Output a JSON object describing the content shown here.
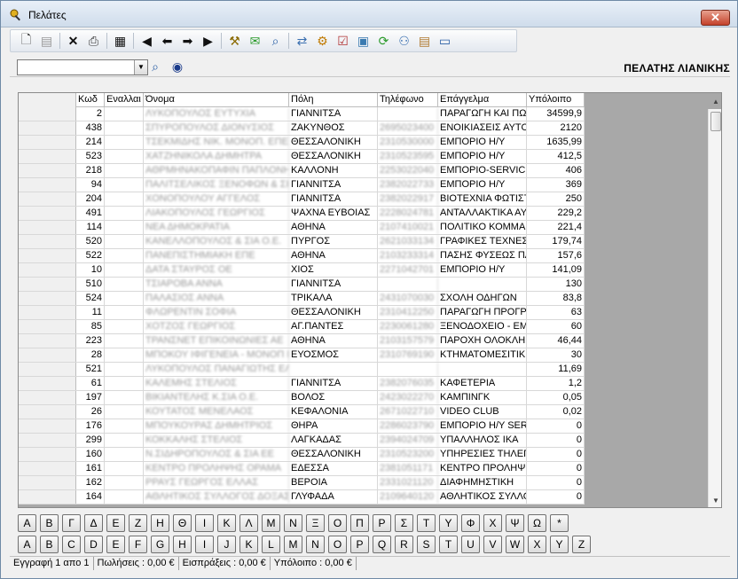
{
  "window": {
    "title": "Πελάτες",
    "close_label": "✕"
  },
  "toolbar": {
    "icons": [
      "new-doc-icon",
      "save-icon",
      "delete-icon",
      "print-icon",
      "grid-view-icon",
      "first-record-icon",
      "prev-record-icon",
      "next-record-icon",
      "last-record-icon",
      "tools-icon",
      "mail-icon",
      "search-doc-icon",
      "export-icon",
      "settings-icon",
      "checklist-icon",
      "id-card-icon",
      "refresh-icon",
      "users-icon",
      "certificate-icon",
      "monitor-icon"
    ]
  },
  "filter": {
    "combo_value": "",
    "customer_label": "ΠΕΛΑΤΗΣ ΛΙΑΝΙΚΗΣ"
  },
  "grid": {
    "headers": [
      "Κωδ",
      "Εναλλαι",
      "Όνομα",
      "Πόλη",
      "Τηλέφωνο",
      "Επάγγελμα",
      "Υπόλοιπο"
    ],
    "rows": [
      [
        "2",
        "",
        "ΛΥΚΟΠΟΥΛΟΣ ΕΥΤΥΧΙΑ",
        "ΓΙΑΝΝΙΤΣΑ",
        "",
        "ΠΑΡΑΓΩΓΗ ΚΑΙ ΠΩΛ",
        "34599,9"
      ],
      [
        "438",
        "",
        "ΣΠΥΡΟΠΟΥΛΟΣ ΔΙΟΝΥΣΙΟΣ",
        "ΖΑΚΥΝΘΟΣ",
        "2695023400",
        "ΕΝΟΙΚΙΑΣΕΙΣ ΑΥΤΟΚ",
        "2120"
      ],
      [
        "214",
        "",
        "ΤΣΕΚΜΙΔΗΣ ΝΙΚ. ΜΟΝΟΠ. ΕΠΕ",
        "ΘΕΣΣΑΛΟΝΙΚΗ",
        "2310530000",
        "ΕΜΠΟΡΙΟ Η/Υ",
        "1635,99"
      ],
      [
        "523",
        "",
        "ΧΑΤΖΗΝΙΚΟΛΑ ΔΗΜΗΤΡΑ",
        "ΘΕΣΣΑΛΟΝΙΚΗ",
        "2310523595",
        "ΕΜΠΟΡΙΟ Η/Υ",
        "412,5"
      ],
      [
        "218",
        "",
        "ΑΘΡΜΗΝΑΚΟΠΑΦΙΝ ΠΑΠΛΟΝΗ",
        "ΚΑΛΛΟΝΗ",
        "2253022040",
        "ΕΜΠΟΡΙΟ-SERVICE",
        "406"
      ],
      [
        "94",
        "",
        "ΠΑΛΙΤΣΕΛΙΚΟΣ ΞΕΝΟΦΩΝ & ΣΙΑ Ο",
        "ΓΙΑΝΝΙΤΣΑ",
        "2382022733",
        "ΕΜΠΟΡΙΟ Η/Υ",
        "369"
      ],
      [
        "204",
        "",
        "ΧΟΝΟΠΟΥΛΟΥ ΑΓΓΕΛΟΣ",
        "ΓΙΑΝΝΙΤΣΑ",
        "2382022917",
        "ΒΙΟΤΕΧΝΙΑ ΦΩΤΙΣΤ",
        "250"
      ],
      [
        "491",
        "",
        "ΛΙΑΚΟΠΟΥΛΟΣ ΓΕΩΡΓΙΟΣ",
        "ΨΑΧΝΑ ΕΥΒΟΙΑΣ",
        "2228024781",
        "ΑΝΤΑΛΛΑΚΤΙΚΑ ΑΥ",
        "229,2"
      ],
      [
        "114",
        "",
        "ΝΕΑ ΔΗΜΟΚΡΑΤΙΑ",
        "ΑΘΗΝΑ",
        "2107410021",
        "ΠΟΛΙΤΙΚΟ ΚΟΜΜΑ",
        "221,4"
      ],
      [
        "520",
        "",
        "ΚΑΝΕΛΛΟΠΟΥΛΟΣ & ΣΙΑ Ο.Ε.",
        "ΠΥΡΓΟΣ",
        "2621033134",
        "ΓΡΑΦΙΚΕΣ ΤΕΧΝΕΣ",
        "179,74"
      ],
      [
        "522",
        "",
        "ΠΑΝΕΠΙΣΤΗΜΙΑΚΗ ΕΠΕ",
        "ΑΘΗΝΑ",
        "2103233314",
        "ΠΑΣΗΣ ΦΥΣΕΩΣ ΠΑΙ",
        "157,6"
      ],
      [
        "10",
        "",
        "ΔΑΤΑ ΣΤΑΥΡΟΣ ΟΕ",
        "ΧΙΟΣ",
        "2271042701",
        "ΕΜΠΟΡΙΟ Η/Υ",
        "141,09"
      ],
      [
        "510",
        "",
        "ΤΣΙΑΡΟΒΑ ΑΝΝΑ",
        "ΓΙΑΝΝΙΤΣΑ",
        "",
        "",
        "130"
      ],
      [
        "524",
        "",
        "ΠΑΛΑΣΙΟΣ ΑΝΝΑ",
        "ΤΡΙΚΑΛΑ",
        "2431070030",
        "ΣΧΟΛΗ ΟΔΗΓΩΝ",
        "83,8"
      ],
      [
        "11",
        "",
        "ΦΛΩΡΕΝΤΙΝ ΣΟΦΙΑ",
        "ΘΕΣΣΑΛΟΝΙΚΗ",
        "2310412250",
        "ΠΑΡΑΓΩΓΗ ΠΡΟΓΡΑ",
        "63"
      ],
      [
        "85",
        "",
        "ΧΟΤΖΟΣ ΓΕΩΡΓΙΟΣ",
        "ΑΓ.ΠΑΝΤΕΣ",
        "2230061280",
        "ΞΕΝΟΔΟΧΕΙΟ - ΕΜΠ",
        "60"
      ],
      [
        "223",
        "",
        "ΤΡΑΝΣΝΕΤ ΕΠΙΚΟΙΝΩΝΙΕΣ ΑΕ",
        "ΑΘΗΝΑ",
        "2103157579",
        "ΠΑΡΟΧΗ ΟΛΟΚΛΗΡΩ",
        "46,44"
      ],
      [
        "28",
        "",
        "ΜΠΟΚΟΥ ΙΦΙΓΕΝΕΙΑ - ΜΟΝΟΠ Ε",
        "ΕΥΟΣΜΟΣ",
        "2310769190",
        "ΚΤΗΜΑΤΟΜΕΣΙΤΙΚΕ",
        "30"
      ],
      [
        "521",
        "",
        "ΛΥΚΟΠΟΥΛΟΣ ΠΑΝΑΓΙΩΤΗΣ ΕΛΕΥ",
        "",
        "",
        "",
        "11,69"
      ],
      [
        "61",
        "",
        "ΚΑΛΕΜΗΣ ΣΤΕΛΙΟΣ",
        "ΓΙΑΝΝΙΤΣΑ",
        "2382076035",
        "ΚΑΦΕΤΕΡΙΑ",
        "1,2"
      ],
      [
        "197",
        "",
        "ΒΙΚΙΑΝΤΕΛΗΣ Κ.ΣΙΑ Ο.Ε.",
        "ΒΟΛΟΣ",
        "2423022270",
        "ΚΑΜΠΙΝΓΚ",
        "0,05"
      ],
      [
        "26",
        "",
        "ΚΟΥΤΑΤΟΣ ΜΕΝΕΛΑΟΣ",
        "ΚΕΦΑΛΟΝΙΑ",
        "2671022710",
        "VIDEO CLUB",
        "0,02"
      ],
      [
        "176",
        "",
        "ΜΠΟΥΚΟΥΡΑΣ ΔΗΜΗΤΡΙΟΣ",
        "ΘΗΡΑ",
        "2286023790",
        "ΕΜΠΟΡΙΟ Η/Υ SERV",
        "0"
      ],
      [
        "299",
        "",
        "ΚΟΚΚΑΛΗΣ ΣΤΕΛΙΟΣ",
        "ΛΑΓΚΑΔΑΣ",
        "2394024709",
        "ΥΠΑΛΛΗΛΟΣ ΙΚΑ",
        "0"
      ],
      [
        "160",
        "",
        "Ν.ΣΙΔΗΡΟΠΟΥΛΟΣ & ΣΙΑ ΕΕ",
        "ΘΕΣΣΑΛΟΝΙΚΗ",
        "2310523200",
        "ΥΠΗΡΕΣΙΕΣ ΤΗΛΕΠΙ",
        "0"
      ],
      [
        "161",
        "",
        "ΚΕΝΤΡΟ ΠΡΟΛΗΨΗΣ ΟΡΑΜΑ",
        "ΕΔΕΣΣΑ",
        "2381051171",
        "ΚΕΝΤΡΟ ΠΡΟΛΗΨΗΣ",
        "0"
      ],
      [
        "162",
        "",
        "ΡΡΑΥΣ ΓΕΩΡΓΟΣ ΕΛΛΑΣ",
        "ΒΕΡΟΙΑ",
        "2331021120",
        "ΔΙΑΦΗΜΗΣΤΙΚΗ",
        "0"
      ],
      [
        "164",
        "",
        "ΑΘΛΗΤΙΚΟΣ ΣΥΛΛΟΓΟΣ ΔΟΞΑΣ",
        "ΓΛΥΦΑΔΑ",
        "2109640120",
        "ΑΘΛΗΤΙΚΟΣ ΣΥΛΛΟ",
        "0"
      ]
    ]
  },
  "alphabet": {
    "greek": [
      "Α",
      "Β",
      "Γ",
      "Δ",
      "Ε",
      "Ζ",
      "Η",
      "Θ",
      "Ι",
      "Κ",
      "Λ",
      "Μ",
      "Ν",
      "Ξ",
      "Ο",
      "Π",
      "Ρ",
      "Σ",
      "Τ",
      "Υ",
      "Φ",
      "Χ",
      "Ψ",
      "Ω",
      "*"
    ],
    "latin": [
      "A",
      "B",
      "C",
      "D",
      "E",
      "F",
      "G",
      "H",
      "I",
      "J",
      "K",
      "L",
      "M",
      "N",
      "O",
      "P",
      "Q",
      "R",
      "S",
      "T",
      "U",
      "V",
      "W",
      "X",
      "Y",
      "Z"
    ]
  },
  "status": {
    "record": "Εγγραφή 1 απο 1",
    "sales": "Πωλήσεις : 0,00 €",
    "receipts": "Εισπράξεις : 0,00 €",
    "balance": "Υπόλοιπο : 0,00 €"
  }
}
